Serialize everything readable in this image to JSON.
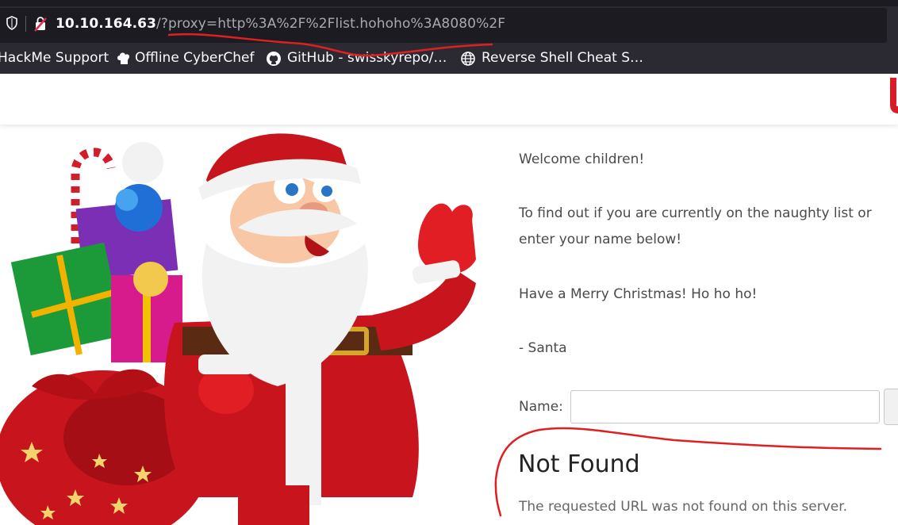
{
  "browser": {
    "url_host": "10.10.164.63",
    "url_rest": "/?proxy=http%3A%2F%2Flist.hohoho%3A8080%2F",
    "bookmarks": [
      {
        "label": "HackMe Support",
        "icon": "none"
      },
      {
        "label": "Offline CyberChef",
        "icon": "chef-hat-icon"
      },
      {
        "label": "GitHub - swisskyrepo/…",
        "icon": "github-icon"
      },
      {
        "label": "Reverse Shell Cheat S…",
        "icon": "globe-icon"
      }
    ]
  },
  "page": {
    "welcome": "Welcome children!",
    "intro_line1": "To find out if you are currently on the naughty list or",
    "intro_line2": "enter your name below!",
    "greeting": "Have a Merry Christmas! Ho ho ho!",
    "signoff": "- Santa",
    "name_label": "Name:",
    "name_value": "",
    "error_heading": "Not Found",
    "error_message": "The requested URL was not found on this server."
  },
  "colors": {
    "chrome_dark": "#1c1b22",
    "chrome": "#2b2a33",
    "annotation_red": "#e02020",
    "brand_red": "#d71e28"
  }
}
